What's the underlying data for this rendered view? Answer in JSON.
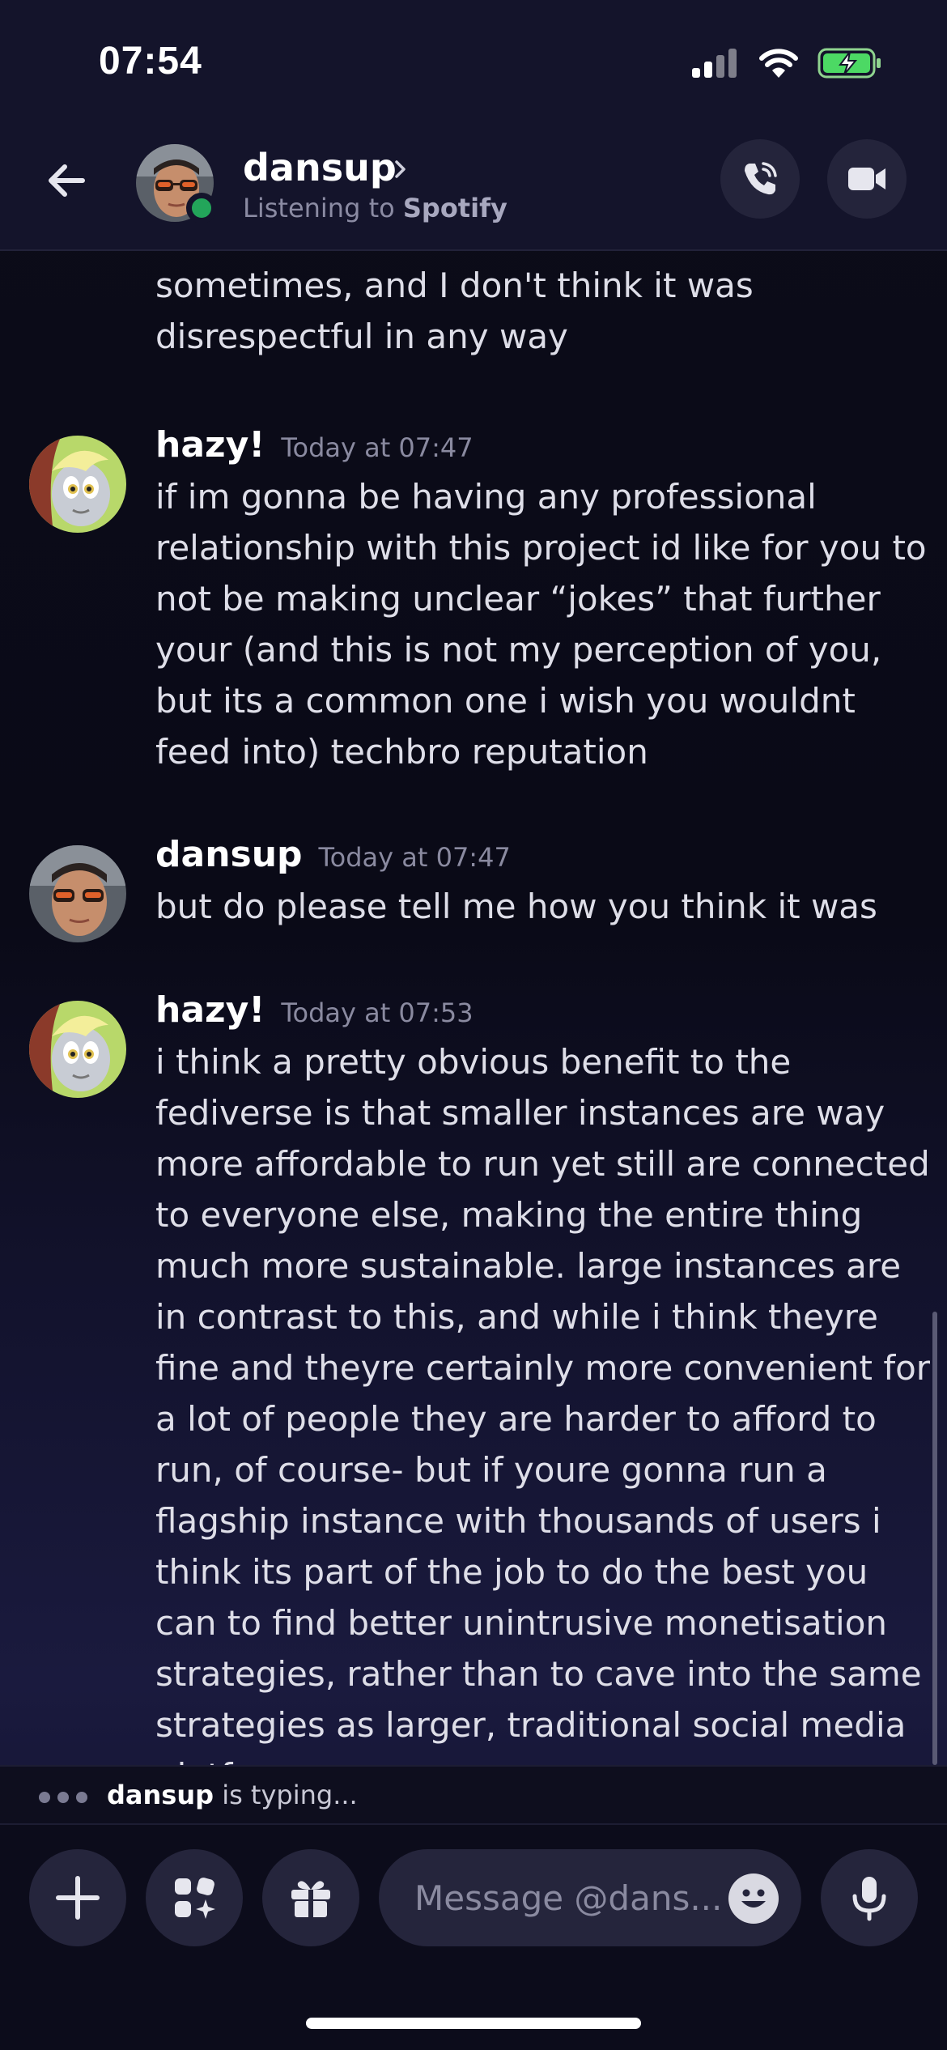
{
  "status_bar": {
    "time": "07:54"
  },
  "header": {
    "name": "dansup",
    "subtitle_prefix": "Listening to ",
    "subtitle_app": "Spotify",
    "icons": [
      "back-arrow-icon",
      "chevron-right-icon",
      "phone-icon",
      "video-icon"
    ]
  },
  "messages": {
    "partial": {
      "lines": [
        "sometimes, and I don't think it was",
        "disrespectful in any way"
      ]
    },
    "m1": {
      "author": "hazy!",
      "timestamp": "Today at 07:47",
      "text": "if im gonna be having any professional relationship with this project id like for you to not be making unclear “jokes” that further your (and this is not my perception of you, but its a common one i wish you wouldnt feed into) techbro reputation"
    },
    "m2": {
      "author": "dansup",
      "timestamp": "Today at 07:47",
      "text": "but do please tell me how you think it was"
    },
    "m3": {
      "author": "hazy!",
      "timestamp": "Today at 07:53",
      "text": "i think a pretty obvious benefit to the fediverse is that smaller instances are way more affordable to run yet still are connected to everyone else, making the entire thing much more sustainable. large instances are in contrast to this, and while i think theyre fine and theyre certainly more convenient for a lot of people they are harder to afford to run, of course- but if youre gonna run a flagship instance with thousands of users i think its part of the job to do the best you can to find better unintrusive monetisation strategies, rather than to cave into the same strategies as larger, traditional social media platforms"
    }
  },
  "typing": {
    "user": "dansup",
    "suffix": " is typing..."
  },
  "composer": {
    "placeholder": "Message @dans...",
    "icons": [
      "plus-icon",
      "apps-icon",
      "gift-icon",
      "emoji-icon",
      "microphone-icon"
    ]
  },
  "colors": {
    "online": "#23a55a",
    "background": "#0b0b18",
    "bar": "#14142b"
  }
}
